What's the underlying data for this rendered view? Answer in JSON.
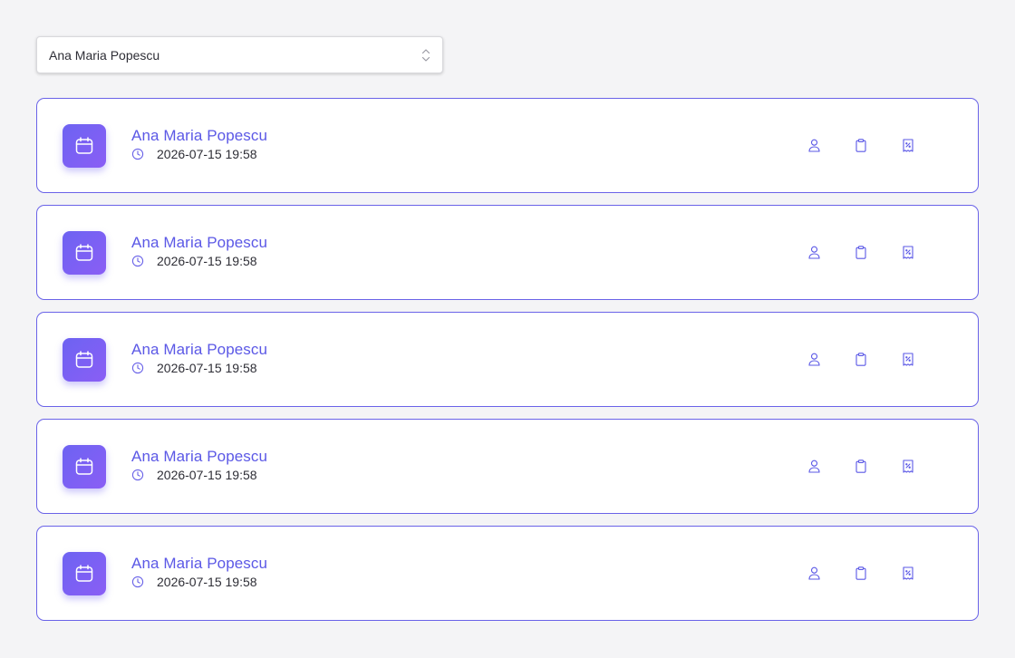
{
  "select": {
    "value": "Ana Maria Popescu"
  },
  "colors": {
    "accent": "#5b58e6",
    "card_border": "#6a63e8",
    "avatar_start": "#6d63f2",
    "avatar_end": "#8a5ef5"
  },
  "cards": [
    {
      "name": "Ana Maria Popescu",
      "datetime": "2026-07-15 19:58"
    },
    {
      "name": "Ana Maria Popescu",
      "datetime": "2026-07-15 19:58"
    },
    {
      "name": "Ana Maria Popescu",
      "datetime": "2026-07-15 19:58"
    },
    {
      "name": "Ana Maria Popescu",
      "datetime": "2026-07-15 19:58"
    },
    {
      "name": "Ana Maria Popescu",
      "datetime": "2026-07-15 19:58"
    }
  ],
  "icons": {
    "avatar": "calendar-icon",
    "time": "clock-icon",
    "actions": [
      "user-icon",
      "clipboard-icon",
      "receipt-icon"
    ]
  }
}
